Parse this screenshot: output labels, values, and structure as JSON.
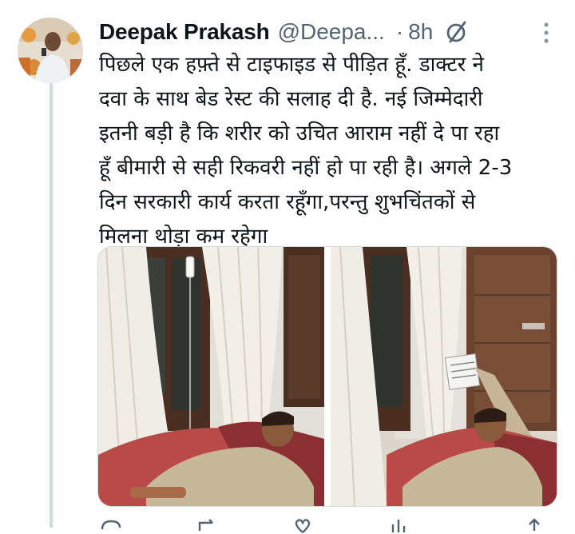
{
  "user": {
    "display_name": "Deepak Prakash",
    "handle": "@Deepa...",
    "separator": "·",
    "time": "8h"
  },
  "tweet": {
    "lines": [
      "पिछले एक हफ़्ते से टाइफाइड से पीड़ित हूँ. डाक्टर ने",
      "दवा के साथ बेड रेस्ट की सलाह दी है. नई जिम्मेदारी",
      "इतनी बड़ी है कि शरीर को उचित आराम नहीं दे पा रहा",
      "हूँ बीमारी से सही रिकवरी नहीं हो पा रही है। अगले 2-3",
      "दिन सरकारी कार्य करता रहूँगा,परन्तु शुभचिंतकों से",
      "मिलना थोड़ा कम रहेगा"
    ]
  },
  "icons": {
    "status": "circle-slash-icon",
    "more": "more-vertical-icon",
    "actions": [
      "reply-icon",
      "retweet-icon",
      "like-icon",
      "views-icon",
      "share-icon"
    ]
  },
  "colors": {
    "text": "#0f1419",
    "secondary": "#536471",
    "border": "#cfd9de"
  }
}
